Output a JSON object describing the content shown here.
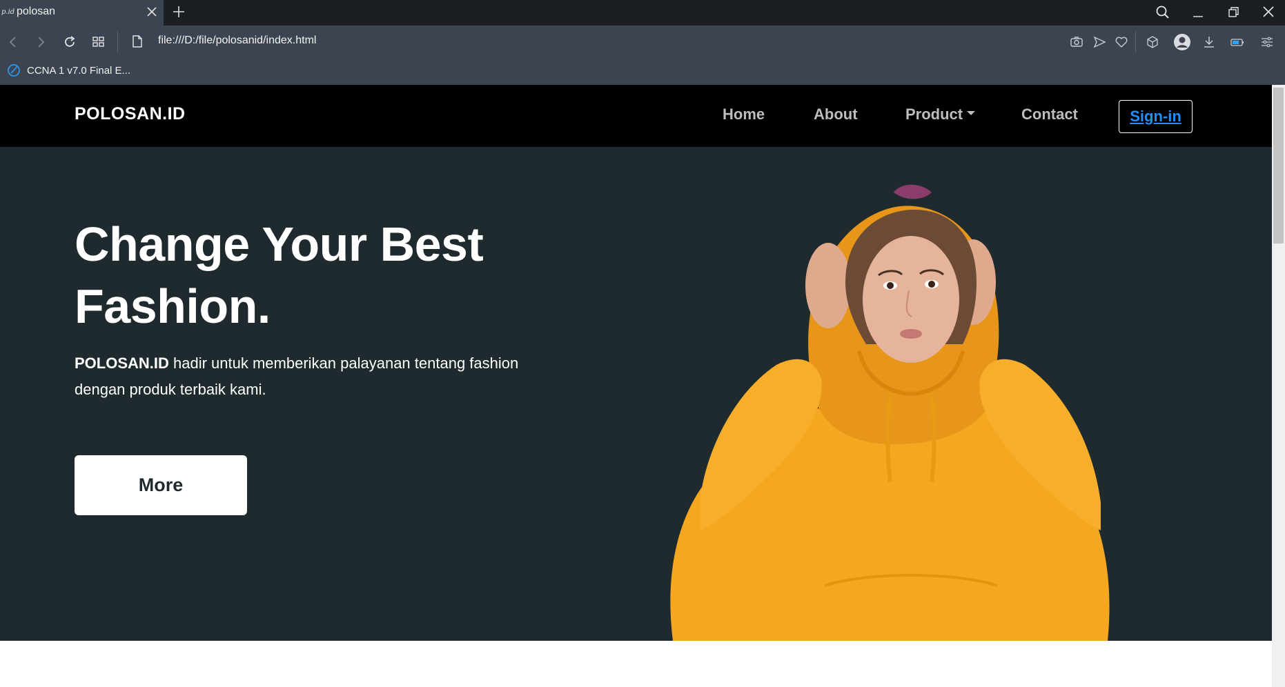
{
  "browser": {
    "tab": {
      "favicon_text": "p.id",
      "title": "polosan"
    },
    "address": "file:///D:/file/polosanid/index.html",
    "bookmarks": [
      {
        "label": "CCNA 1 v7.0 Final E..."
      }
    ],
    "icons": {
      "tab_close": "close-icon",
      "new_tab": "plus-icon",
      "search": "search-icon",
      "minimize": "minimize-icon",
      "restore": "restore-icon",
      "close_window": "close-icon",
      "back": "back-arrow-icon",
      "forward": "forward-arrow-icon",
      "reload": "reload-icon",
      "speed_dial": "grid-icon",
      "page": "file-icon",
      "snapshot": "camera-icon",
      "send": "send-icon",
      "bookmark": "heart-icon",
      "extensions": "cube-icon",
      "profile": "avatar-icon",
      "download": "download-icon",
      "battery": "battery-icon",
      "settings": "sliders-icon"
    }
  },
  "page": {
    "navbar": {
      "brand": "POLOSAN.ID",
      "links": {
        "home": "Home",
        "about": "About",
        "product": "Product",
        "contact": "Contact"
      },
      "signin": "Sign-in"
    },
    "hero": {
      "headline_line1": "Change Your Best",
      "headline_line2": "Fashion.",
      "subtext_brand": "POLOSAN.ID",
      "subtext_rest": " hadir untuk memberikan palayanan tentang fashion dengan produk terbaik kami.",
      "button": "More",
      "image": "woman-in-yellow-hoodie"
    }
  },
  "colors": {
    "tabbar": "#1b1f24",
    "toolbar": "#3b4450",
    "navbar": "#000000",
    "hero": "#1f2a2f",
    "signin_link": "#1f8fff",
    "hoodie": "#f7a81b"
  }
}
